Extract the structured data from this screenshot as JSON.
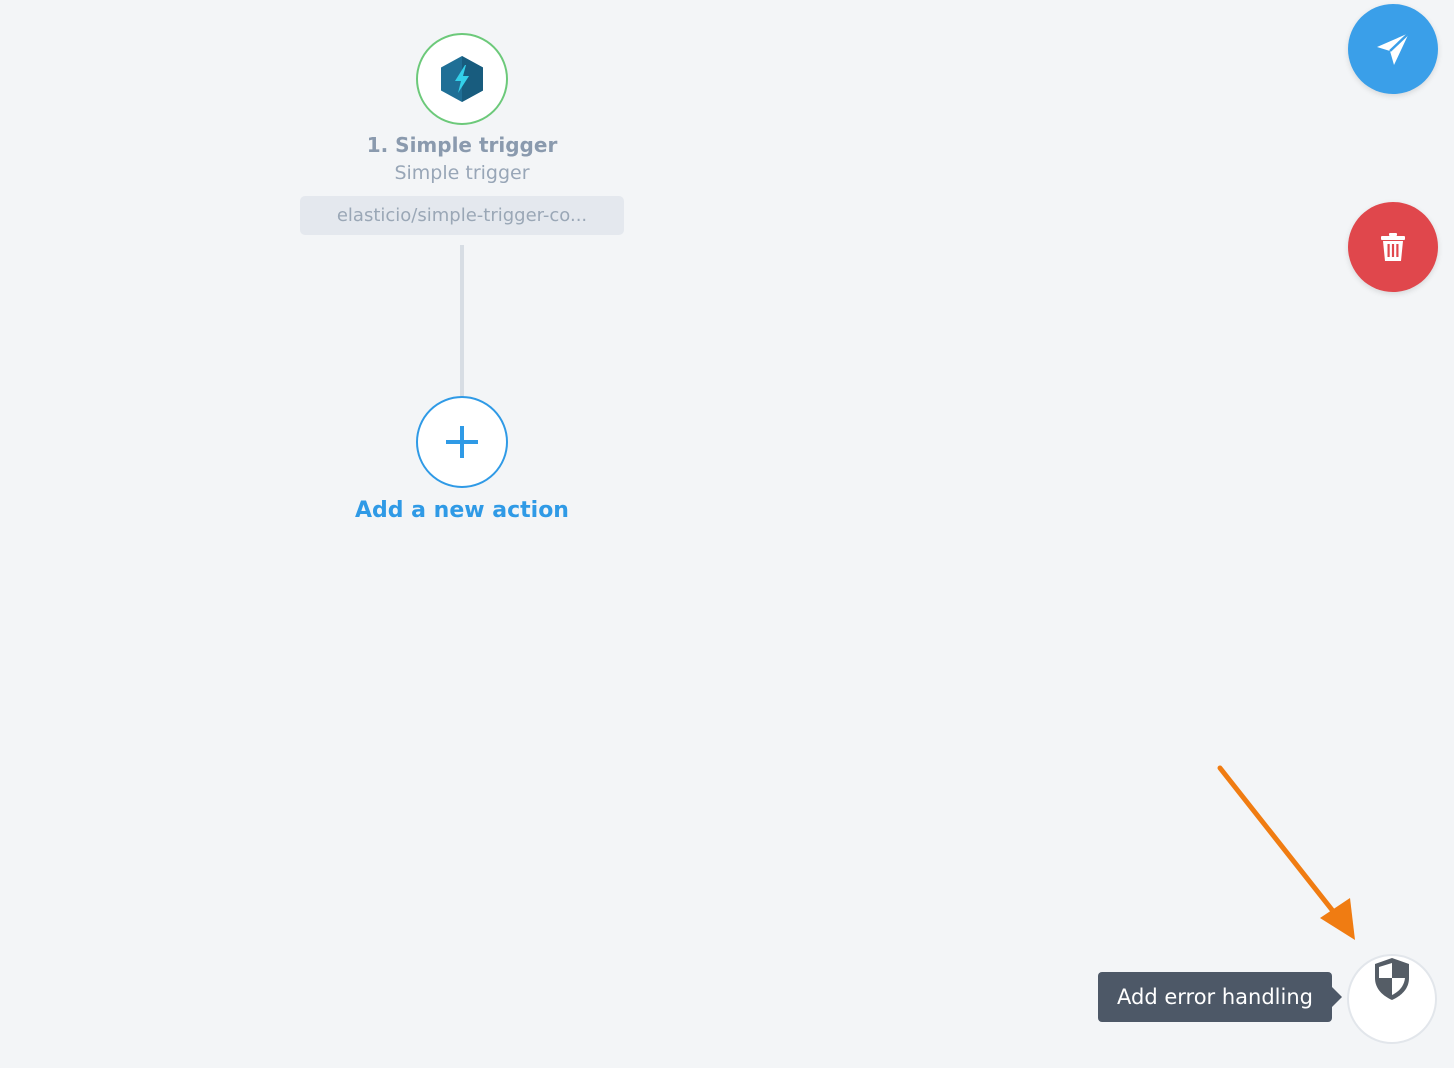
{
  "flow": {
    "trigger": {
      "title": "1. Simple trigger",
      "subtitle": "Simple trigger",
      "component": "elasticio/simple-trigger-co...",
      "icon": "lightning-hexagon-icon",
      "status_color": "#6cc97a"
    },
    "add_action": {
      "label": "Add a new action",
      "icon": "plus-icon",
      "color": "#2f9ae6"
    }
  },
  "actions": {
    "publish": {
      "icon": "paper-plane-icon",
      "color": "#3a9fe9"
    },
    "delete": {
      "icon": "trash-icon",
      "color": "#e0474c"
    },
    "error_handling": {
      "icon": "shield-icon",
      "tooltip": "Add error handling"
    }
  },
  "annotation": {
    "icon": "arrow-icon",
    "color": "#f07c12"
  }
}
